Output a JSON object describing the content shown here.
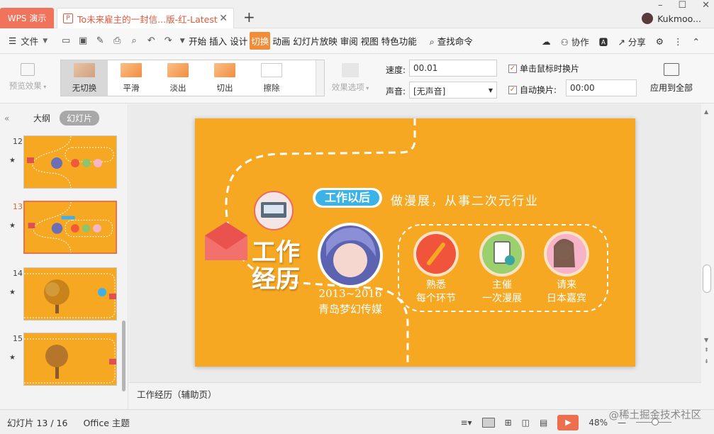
{
  "titlebar": {
    "app_tab": "WPS 演示",
    "doc_tab": "To未来雇主的一封信...版-红-Latest",
    "user": "Kukmoo..."
  },
  "menubar": {
    "file": "文件",
    "items": [
      "开始",
      "插入",
      "设计",
      "切换",
      "动画",
      "幻灯片放映",
      "审阅",
      "视图",
      "特色功能"
    ],
    "active_index": 3,
    "search": "查找命令",
    "collab": "协作",
    "share": "分享"
  },
  "ribbon": {
    "preview": "预览效果",
    "transitions": [
      "无切换",
      "平滑",
      "淡出",
      "切出",
      "擦除"
    ],
    "selected_transition": "无切换",
    "effect_options": "效果选项",
    "speed_label": "速度:",
    "speed_value": "00.01",
    "sound_label": "声音:",
    "sound_value": "[无声音]",
    "on_click_label": "单击鼠标时换片",
    "auto_label": "自动换片:",
    "auto_value": "00:00",
    "apply_all": "应用到全部"
  },
  "leftpanel": {
    "tab_outline": "大纲",
    "tab_slides": "幻灯片",
    "thumbnails": [
      {
        "num": "12",
        "active": false
      },
      {
        "num": "13",
        "active": true
      },
      {
        "num": "14",
        "active": false
      },
      {
        "num": "15",
        "active": false
      }
    ]
  },
  "slide": {
    "title_line1": "工作",
    "title_line2": "经历",
    "badge": "工作以后",
    "subtitle": "做漫展，从事二次元行业",
    "years": "2013~2016",
    "company": "青岛梦幻传媒",
    "items": [
      {
        "line1": "熟悉",
        "line2": "每个环节"
      },
      {
        "line1": "主催",
        "line2": "一次漫展"
      },
      {
        "line1": "请来",
        "line2": "日本嘉宾"
      }
    ]
  },
  "notes": "工作经历（辅助页）",
  "statusbar": {
    "slide_counter": "幻灯片 13 / 16",
    "theme": "Office 主题",
    "zoom": "48%"
  },
  "watermark": "@稀土掘金技术社区",
  "colors": {
    "accent": "#f18d38",
    "slide_bg": "#f7a823",
    "app_tab": "#f0745b"
  }
}
